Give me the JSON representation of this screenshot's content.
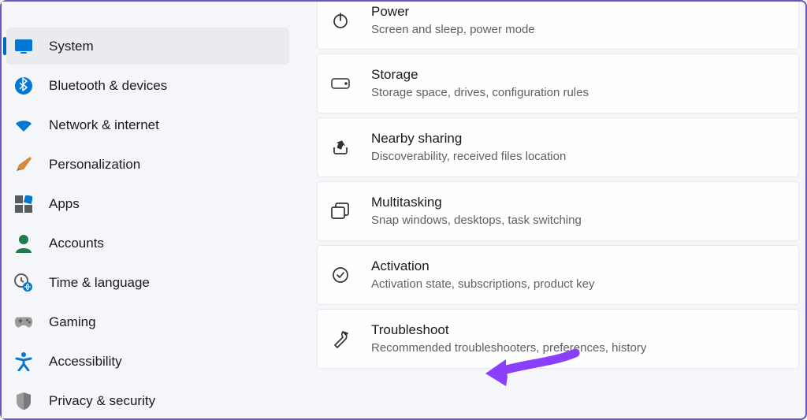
{
  "sidebar": {
    "items": [
      {
        "label": "System",
        "selected": true
      },
      {
        "label": "Bluetooth & devices",
        "selected": false
      },
      {
        "label": "Network & internet",
        "selected": false
      },
      {
        "label": "Personalization",
        "selected": false
      },
      {
        "label": "Apps",
        "selected": false
      },
      {
        "label": "Accounts",
        "selected": false
      },
      {
        "label": "Time & language",
        "selected": false
      },
      {
        "label": "Gaming",
        "selected": false
      },
      {
        "label": "Accessibility",
        "selected": false
      },
      {
        "label": "Privacy & security",
        "selected": false
      }
    ]
  },
  "main": {
    "cards": [
      {
        "title": "Power",
        "desc": "Screen and sleep, power mode"
      },
      {
        "title": "Storage",
        "desc": "Storage space, drives, configuration rules"
      },
      {
        "title": "Nearby sharing",
        "desc": "Discoverability, received files location"
      },
      {
        "title": "Multitasking",
        "desc": "Snap windows, desktops, task switching"
      },
      {
        "title": "Activation",
        "desc": "Activation state, subscriptions, product key"
      },
      {
        "title": "Troubleshoot",
        "desc": "Recommended troubleshooters, preferences, history"
      }
    ]
  },
  "colors": {
    "accent": "#0067c0",
    "arrow": "#8a3ffc"
  }
}
